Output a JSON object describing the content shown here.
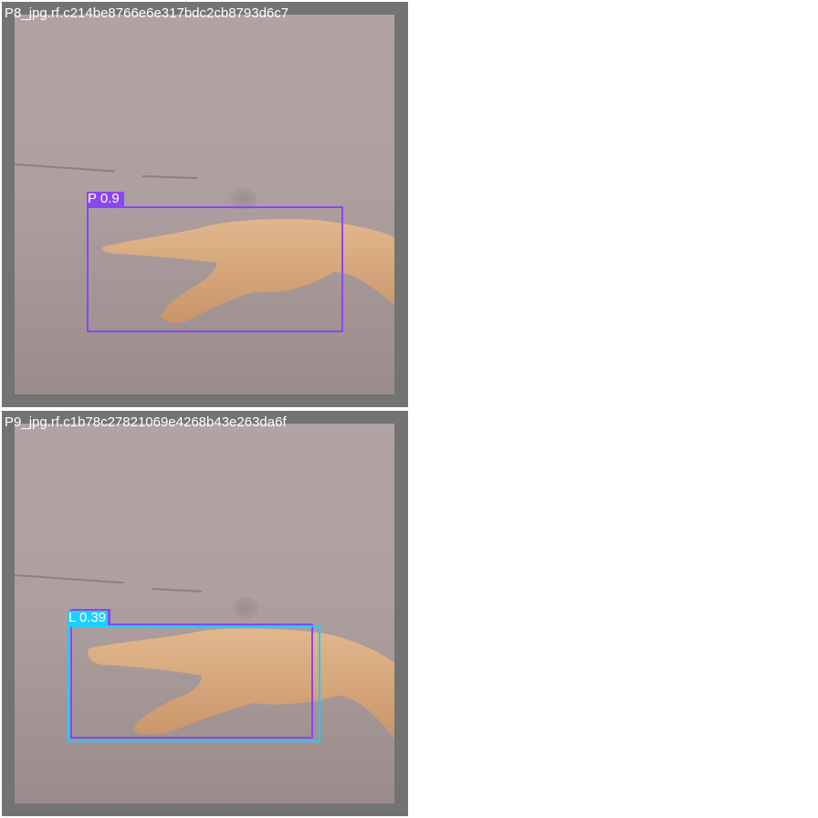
{
  "tiles": [
    {
      "title": "P8_jpg.rf.c214be8766e6e317bdc2cb8793d6c7",
      "detections": [
        {
          "label": "P 0.9",
          "color": "#8a46f0"
        }
      ]
    },
    {
      "title": "P9_jpg.rf.c1b78c27821069e4268b43e263da6f",
      "detections": [
        {
          "label": "L 0.39",
          "color": "#1ecfff"
        },
        {
          "label": "",
          "color": "#8a46f0"
        }
      ]
    }
  ],
  "colors": {
    "frame": "#737373",
    "background": "#ffffff",
    "skin": "#d9ab7f"
  }
}
